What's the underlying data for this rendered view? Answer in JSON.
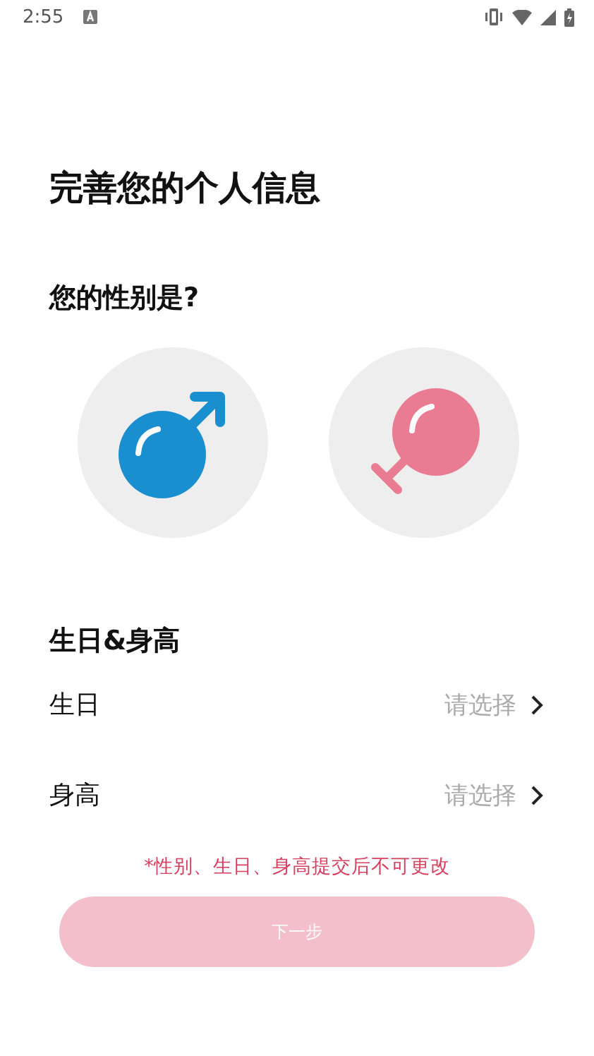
{
  "status_bar": {
    "time": "2:55"
  },
  "title": "完善您的个人信息",
  "gender": {
    "heading": "您的性别是?",
    "options": [
      {
        "kind": "male",
        "selected": false
      },
      {
        "kind": "female",
        "selected": false
      }
    ]
  },
  "details": {
    "heading": "生日&身高",
    "rows": [
      {
        "label": "生日",
        "placeholder": "请选择"
      },
      {
        "label": "身高",
        "placeholder": "请选择"
      }
    ]
  },
  "note": "*性别、生日、身高提交后不可更改",
  "next_button": {
    "label": "下一步",
    "disabled": true
  }
}
